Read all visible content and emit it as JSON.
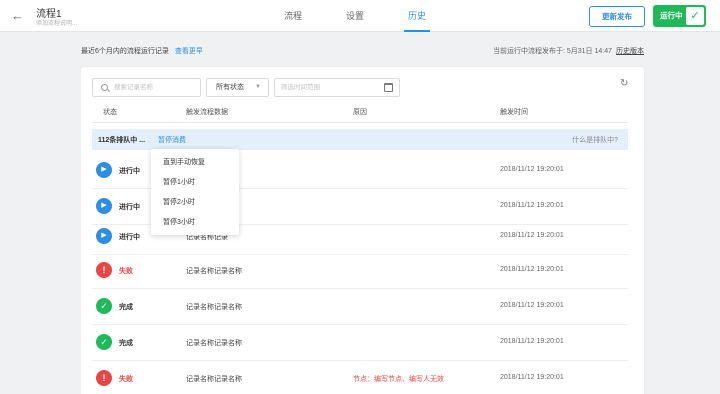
{
  "header": {
    "back_icon": "arrow-left-icon",
    "title": "流程1",
    "subtitle": "添加流程说明...",
    "tabs": [
      {
        "label": "流程",
        "active": false
      },
      {
        "label": "设置",
        "active": false
      },
      {
        "label": "历史",
        "active": true
      }
    ],
    "publish_label": "更新发布",
    "toggle_label": "运行中",
    "toggle_on": true,
    "accent_color": "#2d8ee3",
    "toggle_color": "#1fb95a"
  },
  "info": {
    "left_text": "最近6个月内的流程运行记录",
    "left_link": "查看更早",
    "right_text": "当前运行中流程发布于: 5月31日 14:47",
    "right_link": "历史版本"
  },
  "filters": {
    "search_placeholder": "搜索记录名称",
    "status_value": "所有状态",
    "date_placeholder": "筛选时间范围",
    "refresh_icon": "refresh-icon"
  },
  "table": {
    "columns": [
      "状态",
      "触发流程数据",
      "原因",
      "触发时间"
    ],
    "queue": {
      "count_text": "112条排队中 ...",
      "cancel_text": "暂停消费",
      "help_text": "什么是排队中?"
    },
    "rows": [
      {
        "status": "running",
        "status_label": "进行中",
        "data": "",
        "reason": "",
        "time": "2018/11/12 19:20:01"
      },
      {
        "status": "running",
        "status_label": "进行中",
        "data": "",
        "reason": "",
        "time": "2018/11/12 19:20:01"
      },
      {
        "status": "running",
        "status_label": "进行中",
        "data": "记录名称记录",
        "reason": "",
        "time": "2018/11/12 19:20:01"
      },
      {
        "status": "fail",
        "status_label": "失败",
        "data": "记录名称记录名称",
        "reason": "",
        "time": "2018/11/12 19:20:01"
      },
      {
        "status": "done",
        "status_label": "完成",
        "data": "记录名称记录名称",
        "reason": "",
        "time": "2018/11/12 19:20:01"
      },
      {
        "status": "done",
        "status_label": "完成",
        "data": "记录名称记录名称",
        "reason": "",
        "time": "2018/11/12 19:20:01"
      },
      {
        "status": "fail",
        "status_label": "失败",
        "data": "记录名称记录名称",
        "reason": "节点：编写节点、编写人无效",
        "time": "2018/11/12 19:20:01"
      }
    ]
  },
  "dropdown_menu": {
    "items": [
      "直到手动恢复",
      "暂停1小时",
      "暂停2小时",
      "暂停3小时"
    ]
  },
  "status_colors": {
    "running": "#2d8ee3",
    "done": "#1fb95a",
    "fail": "#e84545"
  }
}
